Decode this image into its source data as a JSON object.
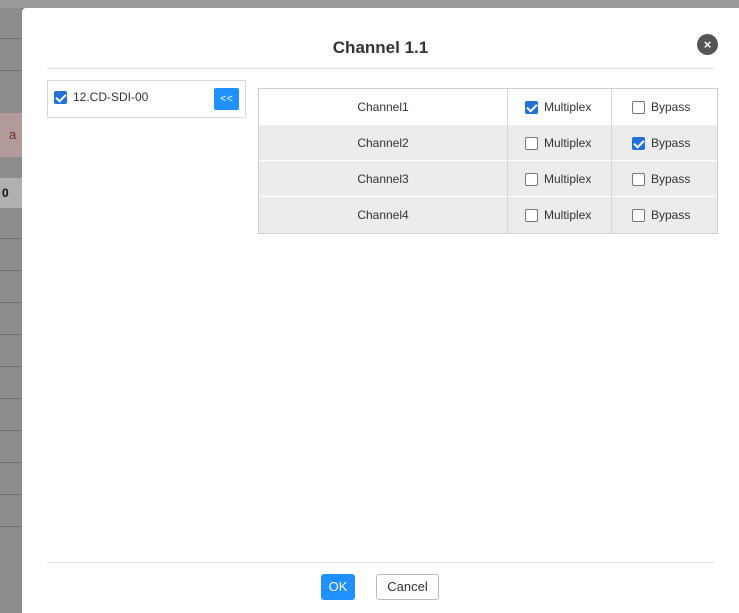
{
  "background": {
    "row_text_a": "a",
    "row_text_0": "0"
  },
  "dialog": {
    "title": "Channel 1.1",
    "close_icon": "×"
  },
  "device_list": {
    "items": [
      {
        "label": "12.CD-SDI-00",
        "checked": true
      }
    ],
    "move_button_label": "<<"
  },
  "channels": [
    {
      "name": "Channel1",
      "multiplex_label": "Multiplex",
      "multiplex": true,
      "bypass_label": "Bypass",
      "bypass": false
    },
    {
      "name": "Channel2",
      "multiplex_label": "Multiplex",
      "multiplex": false,
      "bypass_label": "Bypass",
      "bypass": true
    },
    {
      "name": "Channel3",
      "multiplex_label": "Multiplex",
      "multiplex": false,
      "bypass_label": "Bypass",
      "bypass": false
    },
    {
      "name": "Channel4",
      "multiplex_label": "Multiplex",
      "multiplex": false,
      "bypass_label": "Bypass",
      "bypass": false
    }
  ],
  "footer": {
    "ok_label": "OK",
    "cancel_label": "Cancel"
  },
  "colors": {
    "accent": "#1e90ff",
    "checkbox_checked": "#1e72d9",
    "overlay": "#7a7a7a"
  }
}
